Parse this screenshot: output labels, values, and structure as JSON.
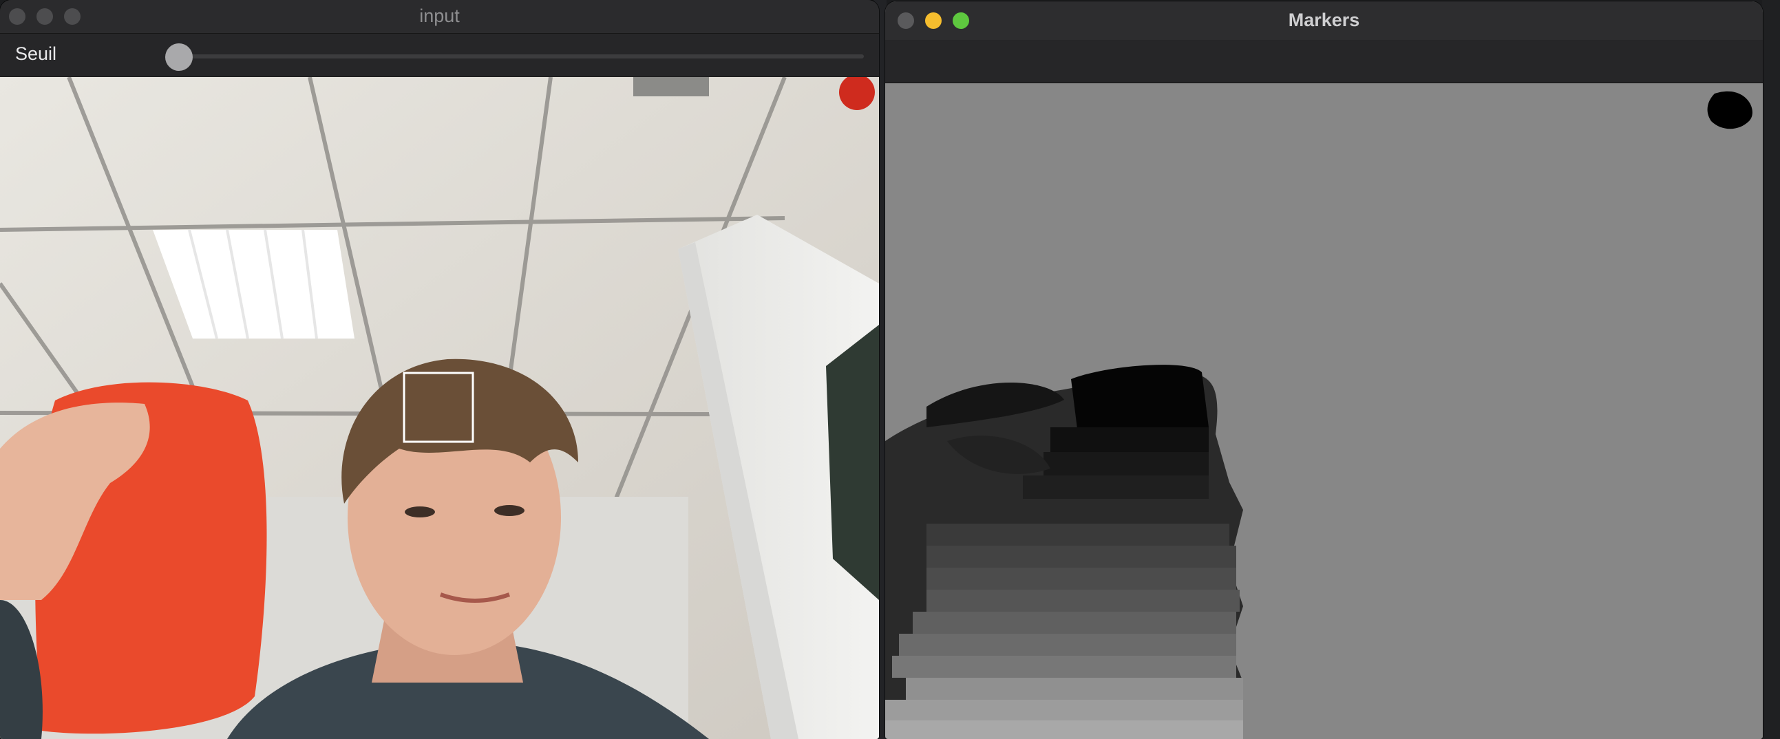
{
  "input_window": {
    "title": "input",
    "traffic_lights": [
      "inactive",
      "inactive",
      "inactive"
    ],
    "toolbar": {
      "slider_label": "Seuil",
      "slider_value": 0
    },
    "camera_view": {
      "content": "webcam-frame",
      "selection_box": true
    }
  },
  "markers_window": {
    "title": "Markers",
    "traffic_lights": [
      "inactive",
      "minimize",
      "zoom"
    ],
    "canvas": {
      "content": "watershed-markers-grayscale",
      "background_color": "#878787"
    }
  },
  "colors": {
    "light_inactive": "#4d4d4f",
    "light_close_inactive": "#5a5a5c",
    "light_minimize": "#f5bd2e",
    "light_zoom": "#5ec83f"
  }
}
